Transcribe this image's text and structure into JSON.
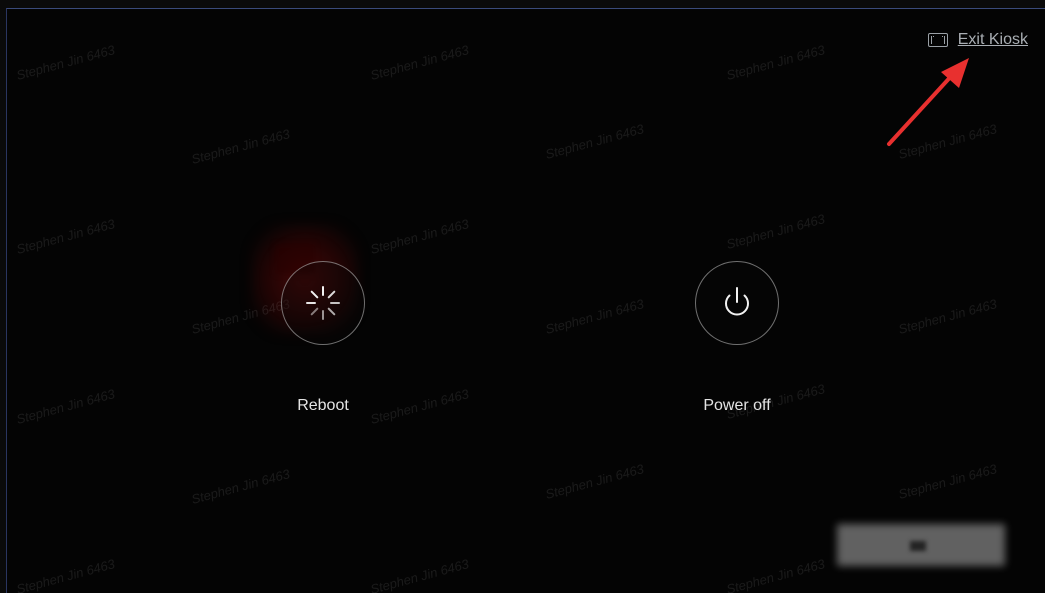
{
  "watermark_text": "Stephen Jin 6463",
  "kiosk": {
    "exit_label": "Exit Kiosk",
    "icon": "filmstrip-icon"
  },
  "actions": {
    "reboot": {
      "label": "Reboot",
      "icon": "spinner-icon"
    },
    "power_off": {
      "label": "Power off",
      "icon": "power-icon"
    }
  },
  "annotation": {
    "arrow_color": "#e8302f"
  }
}
